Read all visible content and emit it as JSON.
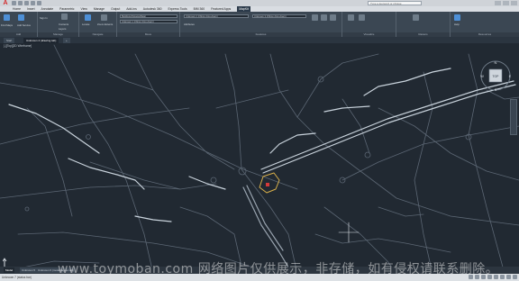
{
  "app": {
    "title_search_placeholder": "Type a keyword or phrase"
  },
  "menu": [
    "Home",
    "Insert",
    "Annotate",
    "Parametric",
    "View",
    "Manage",
    "Output",
    "Add-ins",
    "Autodesk 360",
    "Express Tools",
    "BIM 360",
    "Featured Apps",
    "MapKit"
  ],
  "menu_active_index": 12,
  "ribbon": {
    "panels": [
      {
        "name": "Add",
        "buttons": [
          "Find Maps",
          "Add Service"
        ]
      },
      {
        "name": "Manage",
        "buttons": [
          "Sign In",
          "Contents",
          "Layers"
        ]
      },
      {
        "name": "Navigate",
        "buttons": [
          "Locate",
          "Zoom Extents"
        ]
      },
      {
        "name": "Move",
        "buttons": []
      },
      {
        "name": "Features",
        "buttons": [
          "Attributes"
        ]
      },
      {
        "name": "Visualize",
        "buttons": []
      },
      {
        "name": "Rasters",
        "buttons": []
      },
      {
        "name": "Resources",
        "buttons": [
          "Help"
        ]
      }
    ],
    "basemap_combo": "Buildings/Streets/Water",
    "layer_combo": "Unknown 1 (ribbon drop-down)",
    "feature_combo": "Unknown 2 (ribbon drop-down)",
    "style_combo": "Unknown 3 (ribbon drop-down)"
  },
  "document_tabs": [
    "Start",
    "Unknown 4 (drawing tab)"
  ],
  "viewport_label": "[-][Top][2D Wireframe]",
  "layout_tabs": [
    "Model",
    "Unknown 5 (model/layout tab)",
    "Unknown 6 (model/layout tab)"
  ],
  "status": {
    "mode": "Unknown 7 (status bar)",
    "scale": "Unknown 8 (status bar)"
  },
  "viewcube": {
    "top": "N",
    "bottom": "S",
    "left": "W",
    "right": "E",
    "face": "TOP"
  },
  "watermark": "www.toymoban.com 网络图片仅供展示，非存储，如有侵权请联系删除。",
  "colors": {
    "roads": "#5b6673",
    "highlight_roads": "#c9d3dc",
    "selection": "#d9b04a",
    "marker": "#d43a3a"
  }
}
